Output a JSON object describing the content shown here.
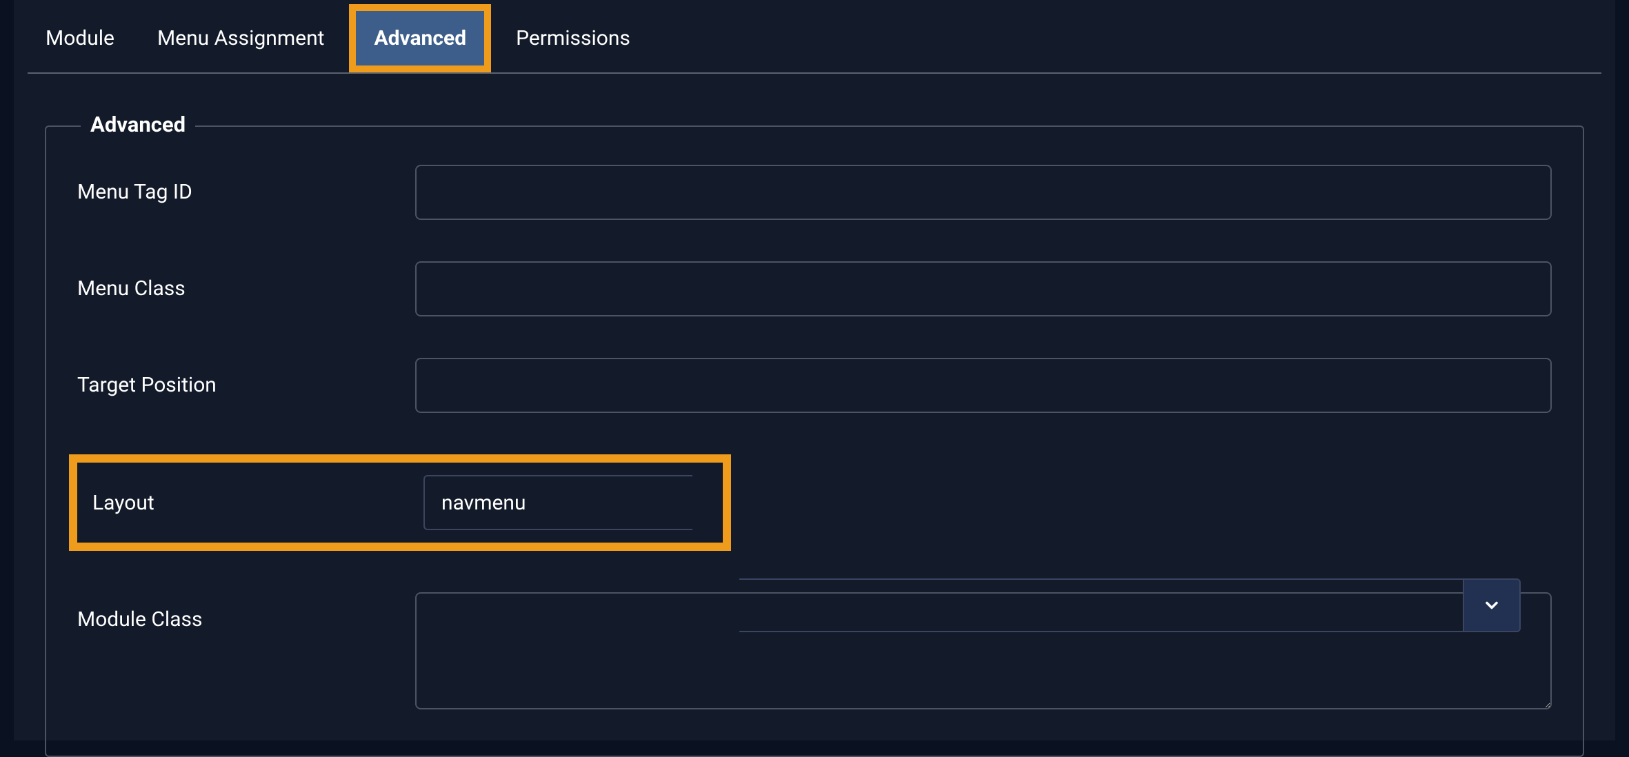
{
  "tabs": {
    "module": "Module",
    "menu_assignment": "Menu Assignment",
    "advanced": "Advanced",
    "permissions": "Permissions"
  },
  "panel": {
    "legend": "Advanced",
    "fields": {
      "menu_tag_id": {
        "label": "Menu Tag ID",
        "value": ""
      },
      "menu_class": {
        "label": "Menu Class",
        "value": ""
      },
      "target_position": {
        "label": "Target Position",
        "value": ""
      },
      "layout": {
        "label": "Layout",
        "value": "navmenu"
      },
      "module_class": {
        "label": "Module Class",
        "value": ""
      }
    }
  }
}
